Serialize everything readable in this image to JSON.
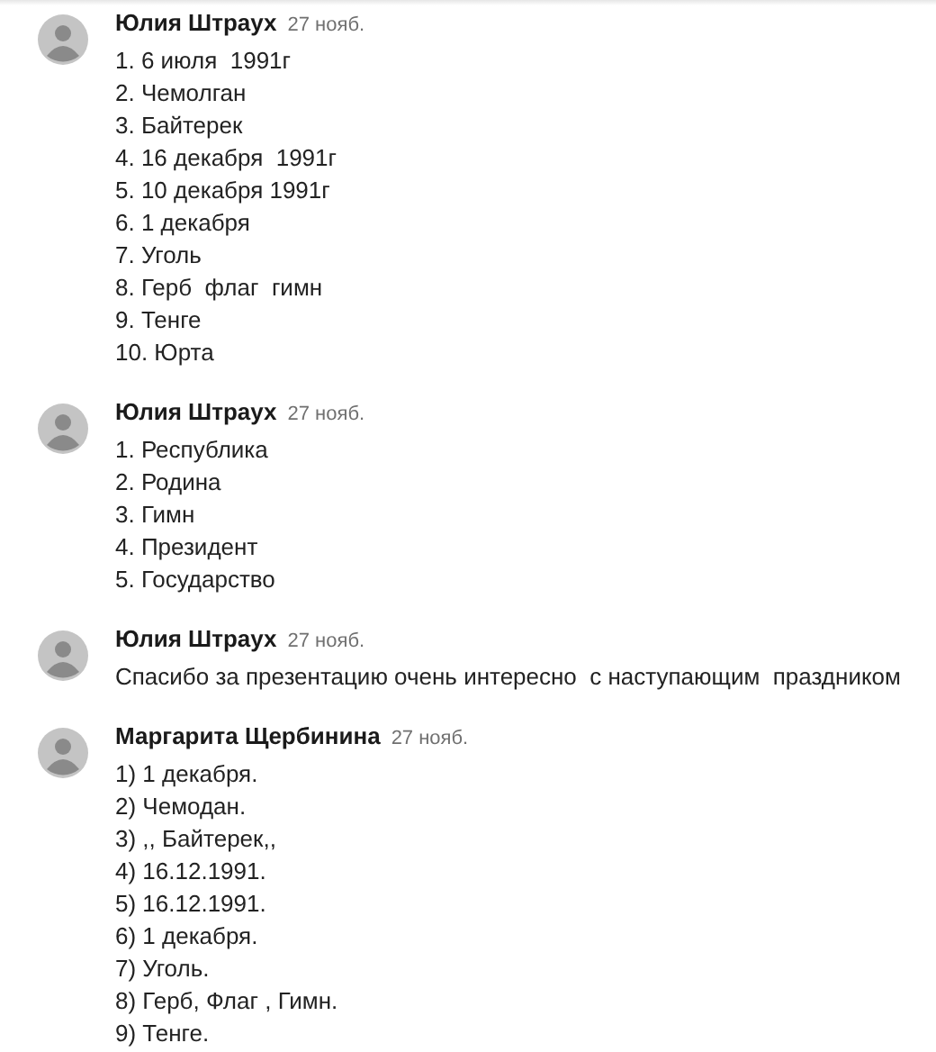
{
  "comments": [
    {
      "author": "Юлия Штраух",
      "date": "27 нояб.",
      "lines": [
        "1. 6 июля  1991г",
        "2. Чемолган",
        "3. Байтерек",
        "4. 16 декабря  1991г",
        "5. 10 декабря 1991г",
        "6. 1 декабря",
        "7. Уголь",
        "8. Герб  флаг  гимн",
        "9. Тенге",
        "10. Юрта"
      ]
    },
    {
      "author": "Юлия Штраух",
      "date": "27 нояб.",
      "lines": [
        "1. Республика",
        "2. Родина",
        "3. Гимн",
        "4. Президент",
        "5. Государство"
      ]
    },
    {
      "author": "Юлия Штраух",
      "date": "27 нояб.",
      "lines": [
        "Спасибо за презентацию очень интересно  с наступающим  праздником"
      ]
    },
    {
      "author": "Маргарита Щербинина",
      "date": "27 нояб.",
      "lines": [
        "1) 1 декабря.",
        "2) Чемодан.",
        "3) ,, Байтерек,,",
        "4) 16.12.1991.",
        "5) 16.12.1991.",
        "6) 1 декабря.",
        "7) Уголь.",
        "8) Герб, Флаг , Гимн.",
        "9) Тенге."
      ]
    }
  ]
}
